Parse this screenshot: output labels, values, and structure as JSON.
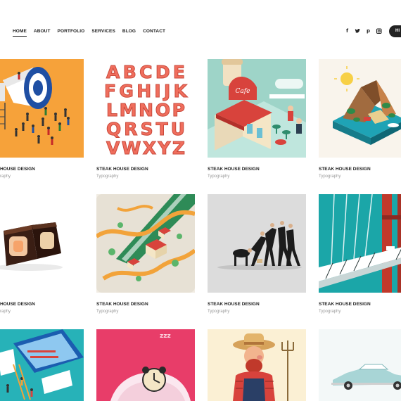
{
  "nav": {
    "items": [
      "HOME",
      "ABOUT",
      "PORTFOLIO",
      "SERVICES",
      "BLOG",
      "CONTACT"
    ],
    "active": "HOME",
    "social_icons": [
      "facebook-icon",
      "twitter-icon",
      "pinterest-icon",
      "instagram-icon"
    ],
    "cta_label": "HI"
  },
  "colors": {
    "text": "#222222",
    "muted": "#999999",
    "orange": "#f6a23a",
    "coral": "#f06e5d",
    "teal": "#1ba6a8"
  },
  "letters": [
    "ABCDE",
    "FGHIJK",
    "LMNOP",
    "QRSTU",
    "VWXYZ"
  ],
  "portfolio": [
    {
      "title": "HOUSE DESIGN",
      "category": "raphy"
    },
    {
      "title": "STEAK HOUSE DESIGN",
      "category": "Typography"
    },
    {
      "title": "STEAK HOUSE DESIGN",
      "category": "Typography"
    },
    {
      "title": "STEAK HOUSE DESIGN",
      "category": "Typography"
    },
    {
      "title": "HOUSE DESIGN",
      "category": "raphy"
    },
    {
      "title": "STEAK HOUSE DESIGN",
      "category": "Typography"
    },
    {
      "title": "STEAK HOUSE DESIGN",
      "category": "Typography"
    },
    {
      "title": "STEAK HOUSE DESIGN",
      "category": "Typography"
    }
  ]
}
